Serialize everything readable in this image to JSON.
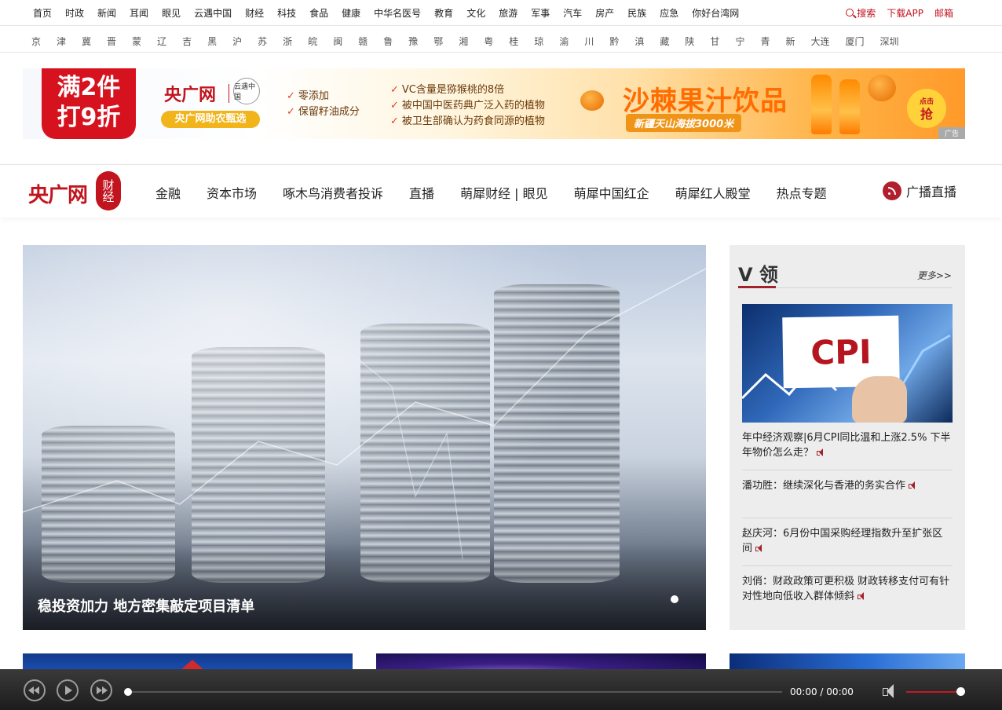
{
  "topnav": {
    "links": [
      "首页",
      "时政",
      "新闻",
      "耳闻",
      "眼见",
      "云遇中国",
      "财经",
      "科技",
      "食品",
      "健康",
      "中华名医号",
      "教育",
      "文化",
      "旅游",
      "军事",
      "汽车",
      "房产",
      "民族",
      "应急",
      "你好台湾网"
    ],
    "search": "搜索",
    "app": "下载APP",
    "mail": "邮箱"
  },
  "regions": [
    "京",
    "津",
    "冀",
    "晋",
    "蒙",
    "辽",
    "吉",
    "黑",
    "沪",
    "苏",
    "浙",
    "皖",
    "闽",
    "赣",
    "鲁",
    "豫",
    "鄂",
    "湘",
    "粤",
    "桂",
    "琼",
    "渝",
    "川",
    "黔",
    "滇",
    "藏",
    "陕",
    "甘",
    "宁",
    "青",
    "新",
    "大连",
    "厦门",
    "深圳"
  ],
  "ad": {
    "badge_line1": "满2件",
    "badge_line2": "打9折",
    "logo": "央广网",
    "logo_seal": "云遇中国",
    "tagline": "央广网助农甄选",
    "features_left": [
      "零添加",
      "保留籽油成分"
    ],
    "features_right": [
      "VC含量是猕猴桃的8倍",
      "被中国中医药典广泛入药的植物",
      "被卫生部确认为药食同源的植物"
    ],
    "headline": "沙棘果汁饮品",
    "subhead": "新疆天山海拔3000米",
    "cta_small": "点击",
    "cta": "抢",
    "label": "广告"
  },
  "brand": {
    "logo": "央广网",
    "seal": "财经",
    "menu": [
      "金融",
      "资本市场",
      "啄木鸟消费者投诉",
      "直播",
      "萌犀财经 | 眼见",
      "萌犀中国红企",
      "萌犀红人殿堂",
      "热点专题"
    ],
    "radio": "广播直播"
  },
  "hero": {
    "caption": "稳投资加力 地方密集敲定项目清单"
  },
  "sidebar": {
    "title": "V 领",
    "more": "更多>>",
    "thumb_text": "CPI",
    "items": [
      "年中经济观察|6月CPI同比温和上涨2.5% 下半年物价怎么走？",
      "潘功胜：继续深化与香港的务实合作",
      "赵庆河：6月份中国采购经理指数升至扩张区间",
      "刘俏：财政政策可更积极 财政转移支付可有针对性地向低收入群体倾斜"
    ]
  },
  "player": {
    "time_current": "00:00",
    "time_sep": "/",
    "time_total": "00:00"
  },
  "colors": {
    "brand_red": "#c2141f",
    "player_bg": "#2a2a2a",
    "sidebar_bg": "#ededed"
  }
}
